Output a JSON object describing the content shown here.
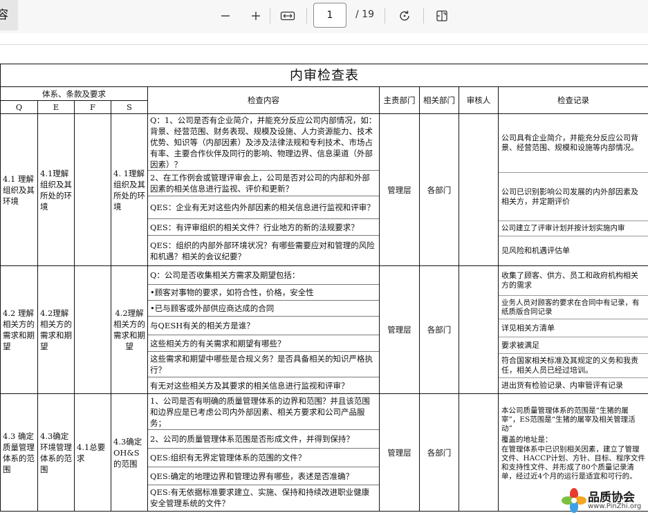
{
  "toolbar": {
    "left_text": "容",
    "page_current": "1",
    "page_total": "/ 19",
    "icons": [
      "zoom-out-icon",
      "zoom-in-icon",
      "fit-width-icon",
      "rotate-icon",
      "page-view-icon"
    ]
  },
  "doc": {
    "title": "内审检查表",
    "headers": {
      "group": "体系、条款及要求",
      "q": "Q",
      "e": "E",
      "f": "F",
      "s": "S",
      "content": "检查内容",
      "main_dept": "主责部门",
      "rel_dept": "相关部门",
      "auditor": "审核人",
      "record": "检查记录"
    },
    "sections": [
      {
        "q": "4.1 理解组织及其环境",
        "e": "4.1理解组织及其所处的环境",
        "f": "",
        "s": "4. 1理解组织及其所处的环境",
        "main": "管理层",
        "rel": "各部门",
        "items": [
          "Q：1、公司是否有企业简介，并能充分反应公司内部情况，如：背景、经营范围、财务表现、规模及设施、人力资源能力、技术优势、知识等（内部因素）及涉及法律法规和专利技术、市场占有率、主要合作伙伴及同行的影响、物理边界、信息渠道（外部因素）？",
          "2、在工作例会或管理评审会上，公司是否对公司的内部和外部因素的相关信息进行监视、评价和更新？",
          "QES：企业有无对这些内外部因素的相关信息进行监视和评审？",
          "QES：有评审组织的相关文件？行业地方的新的法规要求？",
          "QES：组织的内部外部环境状况？有哪些需要应对和管理的风险和机遇？相关的会议纪要？"
        ],
        "records": [
          "公司具有企业简介，并能充分反应公司背景、经营范围、规模和设施等内部情况。",
          "公司已识别影响公司发展的内外部因素及相关方，并定期评价",
          "公司建立了评审计划并按计划实施内审",
          "见风险和机遇评估单"
        ]
      },
      {
        "q": "4.2 理解相关方的需求和期望",
        "e": "4.2理解相关方的需求和期望",
        "f": "",
        "s": "4.2理解相关方的需求和期望",
        "main": "管理层",
        "rel": "各部门",
        "items": [
          "Q：公司是否收集相关方需求及期望包括：",
          "•顾客对事物的要求，如符合性，价格，安全性",
          "•已与顾客或外部供应商达成的合同",
          "与QESH有关的相关方是谁？",
          "这些相关方的有关需求和期望有哪些？",
          "这些需求和期望中哪些是合规义务？是否具备相关的知识严格执行？",
          "有无对这些相关方及其要求的相关信息进行监视和评审？"
        ],
        "records": [
          "收集了顾客、供方、员工和政府机构相关方的需求",
          "业务人员对顾客的要求在合同中有记录，有纸质版合同记录",
          "详见相关方清单",
          "要求被满足",
          "符合国家相关标准及其规定的义务和我责任，相关人员已经过培训。",
          "进出货有检验记录、内审管评有记录"
        ]
      },
      {
        "q": "4.3 确定质量管理体系的范围",
        "e": "4.3确定环境管理体系的范围",
        "f": "4.1总要求",
        "s": "4.3确定OH&S的范围",
        "main": "管理层",
        "rel": "各部门",
        "items": [
          "1、公司是否有明确的质量管理体系的边界和范围？并且该范围和边界应是已考虑公司内外部因素、相关方要求和公司产品服务；",
          "2、公司的质量管理体系范围是否形成文件，并得到保持？",
          "QES:组织有无界定管理体系的范围的文件？",
          "QES:确定的地理边界和管理边界有哪些，表述是否准确？",
          "QES:有无依据标准要求建立、实施、保持和持续改进职业健康安全管理系统的文件？"
        ],
        "records": [
          "本公司质量管理体系的范围是“生猪的屠宰”，ES范围是“生猪的屠宰及相关管理活动”",
          "覆盖的地址是：",
          "在管理体系中已识别相关因素，建立了管理文件、HACCP计划、方针、目标、程序文件和支持性文件、并形成了80个质量记录清单，经过近4个月的运行是适宜和可行的。"
        ]
      }
    ]
  },
  "logo": {
    "name": "品质协会",
    "url": "www.PinZhi.org",
    "colors": [
      "#e63b2e",
      "#f5a623",
      "#3aa0e8",
      "#7bc043"
    ]
  }
}
